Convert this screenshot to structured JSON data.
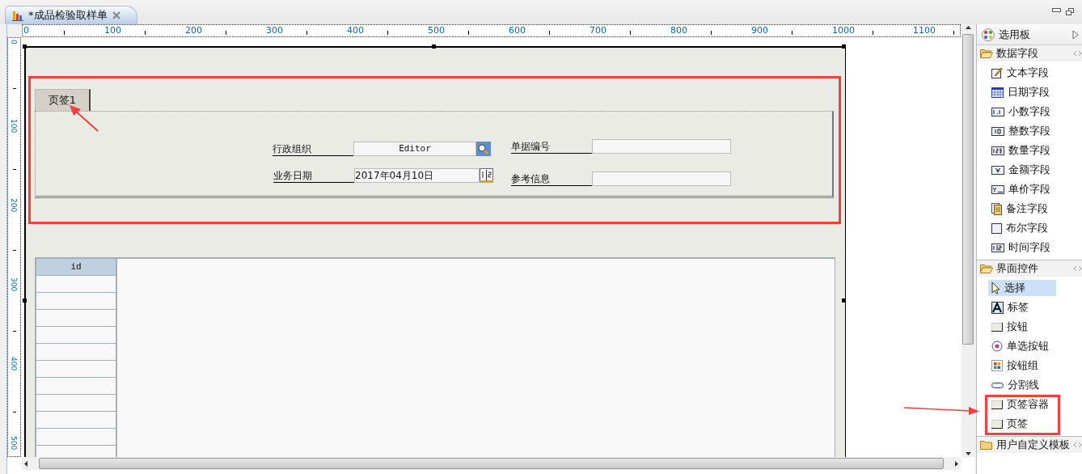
{
  "editor_tab": {
    "title": "*成品检验取样单",
    "selected": true
  },
  "ruler": {
    "horizontal": [
      "0",
      "100",
      "200",
      "300",
      "400",
      "500",
      "600",
      "700",
      "800",
      "900",
      "1000",
      "1100"
    ],
    "vertical": [
      "0",
      "100",
      "200",
      "300",
      "400",
      "500"
    ]
  },
  "form": {
    "tabs": [
      {
        "label": "页签1",
        "selected": true
      }
    ],
    "fields": [
      {
        "label": "行政组织",
        "value": "Editor",
        "kind": "lookup"
      },
      {
        "label": "单据编号",
        "kind": "text"
      },
      {
        "label": "业务日期",
        "value": "2017年04月10日",
        "kind": "date"
      },
      {
        "label": "参考信息",
        "kind": "text"
      }
    ],
    "grid": {
      "columns": [
        "id"
      ]
    }
  },
  "palette": {
    "title": "选用板",
    "sections": [
      {
        "title": "数据字段",
        "expanded": true,
        "items": [
          {
            "label": "文本字段",
            "kind": "text",
            "selected": false
          },
          {
            "label": "日期字段",
            "kind": "date",
            "selected": false
          },
          {
            "label": "小数字段",
            "kind": "decimal",
            "selected": false
          },
          {
            "label": "整数字段",
            "kind": "integer",
            "selected": false
          },
          {
            "label": "数量字段",
            "kind": "quantity",
            "selected": false
          },
          {
            "label": "金额字段",
            "kind": "amount",
            "selected": false
          },
          {
            "label": "单价字段",
            "kind": "price",
            "selected": false
          },
          {
            "label": "备注字段",
            "kind": "memo",
            "selected": false
          },
          {
            "label": "布尔字段",
            "kind": "boolean",
            "selected": false
          },
          {
            "label": "时间字段",
            "kind": "time",
            "selected": false
          }
        ]
      },
      {
        "title": "界面控件",
        "expanded": true,
        "items": [
          {
            "label": "选择",
            "kind": "pointer",
            "selected": true
          },
          {
            "label": "标签",
            "kind": "label",
            "selected": false
          },
          {
            "label": "按钮",
            "kind": "button",
            "selected": false
          },
          {
            "label": "单选按钮",
            "kind": "radio",
            "selected": false
          },
          {
            "label": "按钮组",
            "kind": "buttongroup",
            "selected": false
          },
          {
            "label": "分割线",
            "kind": "separator",
            "selected": false
          },
          {
            "label": "页签容器",
            "kind": "button",
            "selected": false
          },
          {
            "label": "页签",
            "kind": "button",
            "selected": false
          }
        ]
      },
      {
        "title": "用户自定义模板",
        "expanded": false
      }
    ]
  }
}
